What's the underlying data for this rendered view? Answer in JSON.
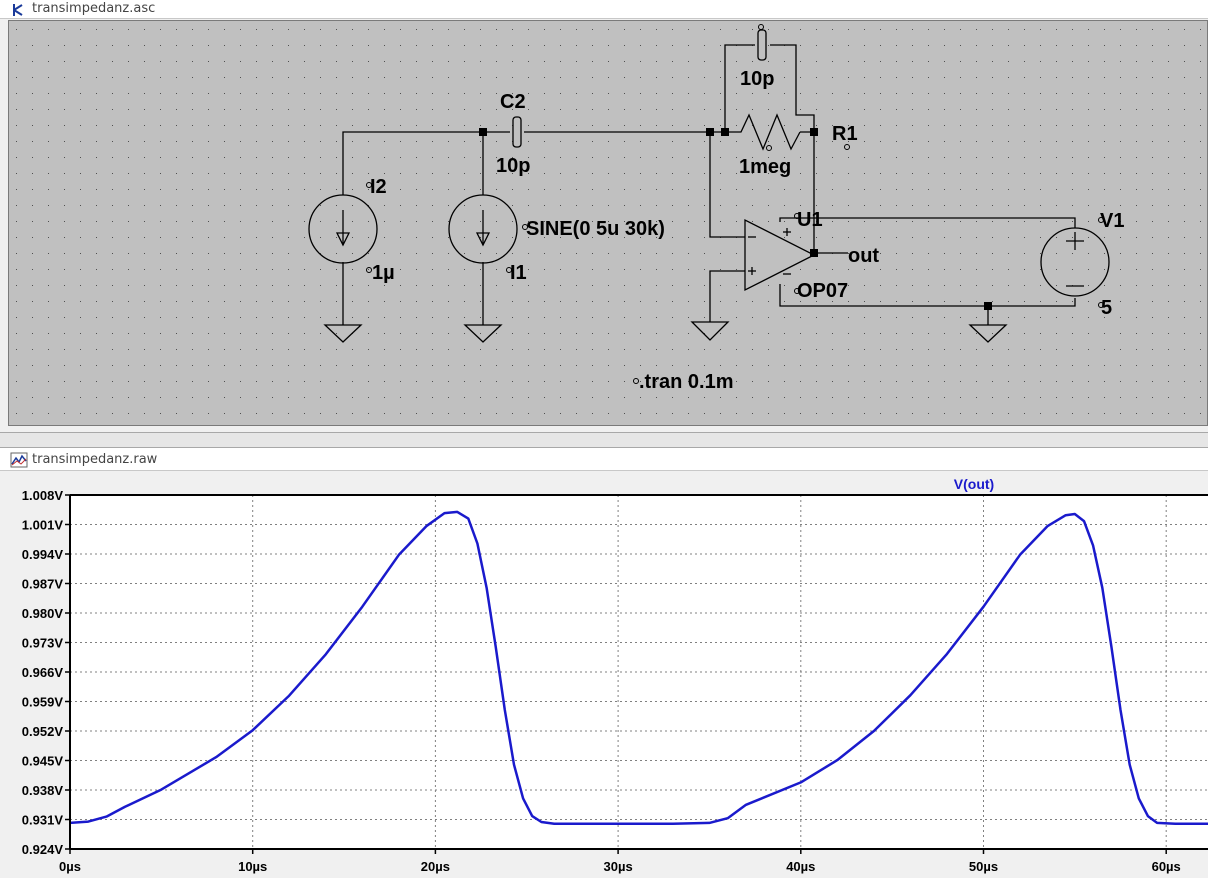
{
  "schematic": {
    "title": "transimpedanz.asc",
    "labels": {
      "c2_name": "C2",
      "c2_value": "10p",
      "cf_value": "10p",
      "r1_name": "R1",
      "r1_value": "1meg",
      "i2_name": "I2",
      "i2_value": "1µ",
      "i1_name": "I1",
      "i1_value": "SINE(0 5u 30k)",
      "u1_name": "U1",
      "u1_model": "OP07",
      "out_label": "out",
      "v1_name": "V1",
      "v1_value": "5",
      "directive": ".tran 0.1m"
    }
  },
  "plot_window": {
    "title": "transimpedanz.raw"
  },
  "chart_data": {
    "type": "line",
    "title": "V(out)",
    "xlabel": "",
    "ylabel": "",
    "xlim": [
      0,
      63
    ],
    "ylim": [
      0.924,
      1.008
    ],
    "x_ticks": [
      "0µs",
      "10µs",
      "20µs",
      "30µs",
      "40µs",
      "50µs",
      "60µs"
    ],
    "y_ticks": [
      "1.008V",
      "1.001V",
      "0.994V",
      "0.987V",
      "0.980V",
      "0.973V",
      "0.966V",
      "0.959V",
      "0.952V",
      "0.945V",
      "0.938V",
      "0.931V",
      "0.924V"
    ],
    "grid": true,
    "color": "#1a1acc",
    "series": [
      {
        "name": "V(out)",
        "x": [
          0,
          1,
          2,
          3,
          5,
          8,
          10,
          12,
          14,
          16,
          18,
          19.5,
          20.5,
          21.2,
          21.8,
          22.3,
          22.8,
          23.3,
          23.8,
          24.3,
          24.8,
          25.3,
          25.8,
          26.5,
          28,
          30,
          33,
          35,
          36,
          37,
          40,
          42,
          44,
          46,
          48,
          50,
          52,
          53.5,
          54.5,
          55,
          55.5,
          56,
          56.5,
          57,
          57.5,
          58,
          58.5,
          59,
          59.5,
          60.5,
          63
        ],
        "y": [
          0.9302,
          0.9305,
          0.9317,
          0.934,
          0.9381,
          0.9458,
          0.9522,
          0.9604,
          0.9702,
          0.9815,
          0.9938,
          1.0006,
          1.0037,
          1.004,
          1.0024,
          0.9965,
          0.986,
          0.972,
          0.957,
          0.944,
          0.936,
          0.9318,
          0.9304,
          0.93,
          0.93,
          0.93,
          0.93,
          0.9302,
          0.9313,
          0.9345,
          0.9398,
          0.9451,
          0.952,
          0.9605,
          0.9703,
          0.9815,
          0.9938,
          1.0006,
          1.0032,
          1.0035,
          1.0018,
          0.996,
          0.986,
          0.972,
          0.957,
          0.944,
          0.936,
          0.9318,
          0.9302,
          0.93,
          0.93
        ]
      }
    ]
  }
}
